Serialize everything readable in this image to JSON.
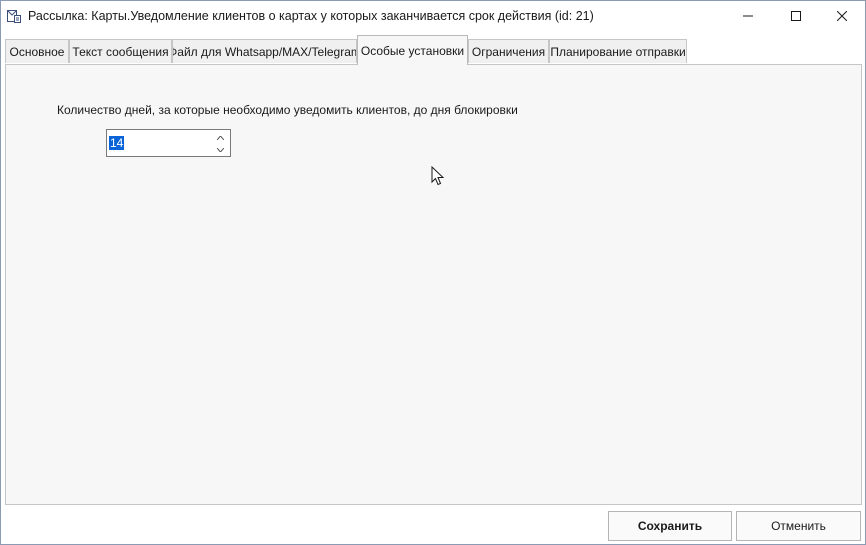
{
  "window": {
    "title": "Рассылка: Карты.Уведомление клиентов о картах у которых заканчивается срок действия (id: 21)"
  },
  "icons": {
    "app": "mail-document-icon",
    "minimize": "minimize-icon",
    "maximize": "maximize-icon",
    "close": "close-icon",
    "spin_up": "chevron-up-icon",
    "spin_down": "chevron-down-icon",
    "cursor": "mouse-pointer-icon"
  },
  "tabs": [
    {
      "label": "Основное"
    },
    {
      "label": "Текст сообщения"
    },
    {
      "label": "Файл для Whatsapp/MAX/Telegram"
    },
    {
      "label": "Особые установки"
    },
    {
      "label": "Ограничения"
    },
    {
      "label": "Планирование отправки"
    }
  ],
  "active_tab": "Особые установки",
  "settings": {
    "days_label": "Количество дней, за которые необходимо уведомить клиентов, до дня блокировки",
    "days_value": "14"
  },
  "footer": {
    "save_label": "Сохранить",
    "cancel_label": "Отменить"
  },
  "colors": {
    "selection": "#0a64d8",
    "content_bg": "#f7f7f7",
    "border": "#c6c6c6"
  }
}
